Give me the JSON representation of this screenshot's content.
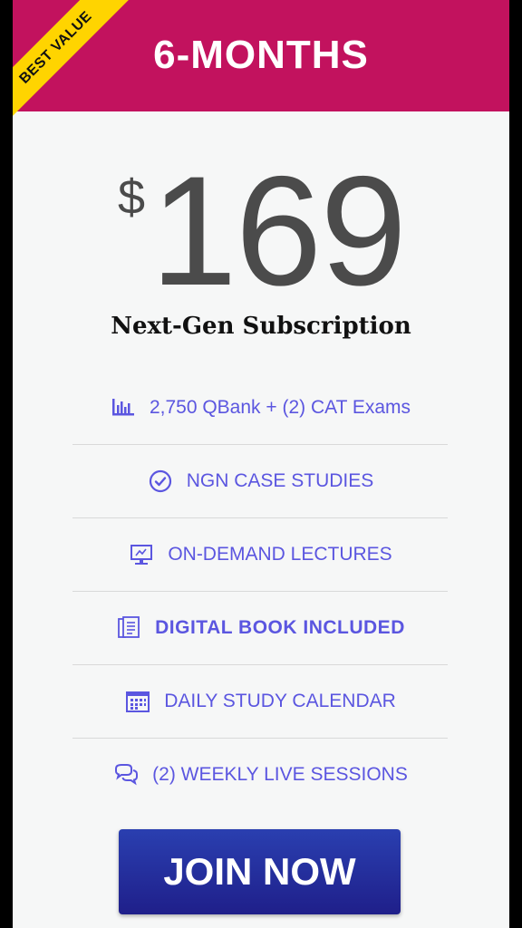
{
  "header": {
    "title": "6-MONTHS",
    "ribbon": "BEST VALUE"
  },
  "price": {
    "currency": "$",
    "amount": "169"
  },
  "plan": {
    "name": "Next-Gen Subscription"
  },
  "features": [
    {
      "label": "2,750 QBank + (2) CAT Exams",
      "icon": "bar-chart-icon"
    },
    {
      "label": "NGN CASE STUDIES",
      "icon": "check-circle-icon"
    },
    {
      "label": "ON-DEMAND LECTURES",
      "icon": "monitor-icon"
    },
    {
      "label": "DIGITAL BOOK INCLUDED",
      "icon": "book-icon"
    },
    {
      "label": "DAILY STUDY CALENDAR",
      "icon": "calendar-icon"
    },
    {
      "label": "(2) WEEKLY LIVE SESSIONS",
      "icon": "chat-bubbles-icon"
    }
  ],
  "cta": {
    "label": "JOIN NOW"
  },
  "colors": {
    "header": "#c2125e",
    "ribbon": "#ffd400",
    "accent": "#5b56e0",
    "button": "#2a3fb0"
  }
}
